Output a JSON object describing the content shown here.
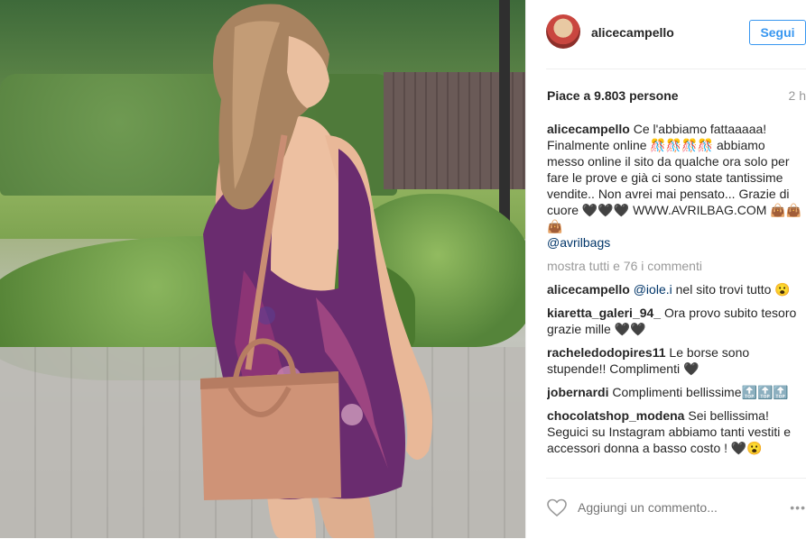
{
  "post": {
    "username": "alicecampello",
    "follow_label": "Segui",
    "likes": "Piace a 9.803 persone",
    "time": "2 h",
    "caption_text": " Ce l'abbiamo fattaaaaa! Finalmente online 🎊🎊🎊🎊 abbiamo messo online il sito da qualche ora solo per fare le prove e già ci sono state tantissime vendite.. Non avrei mai pensato... Grazie di cuore 🖤🖤🖤 WWW.AVRILBAG.COM 👜👜👜",
    "caption_mention": "@avrilbags",
    "load_more": "mostra tutti e 76 i commenti",
    "comments": [
      {
        "author": "alicecampello",
        "mention": "@iole.i",
        "text": " nel sito trovi tutto 😮"
      },
      {
        "author": "kiaretta_galeri_94_",
        "mention": "",
        "text": " Ora provo subito tesoro grazie mille 🖤🖤"
      },
      {
        "author": "racheledodopires11",
        "mention": "",
        "text": " Le borse sono stupende!! Complimenti 🖤"
      },
      {
        "author": "jobernardi",
        "mention": "",
        "text": " Complimenti bellissime🔝🔝🔝"
      },
      {
        "author": "chocolatshop_modena",
        "mention": "",
        "text": " Sei bellissima! Seguici su Instagram abbiamo tanti vestiti e accessori donna a basso costo ! 🖤😮"
      }
    ],
    "add_comment_placeholder": "Aggiungi un commento...",
    "more_label": "•••"
  },
  "colors": {
    "accent": "#3897f0",
    "text": "#262626",
    "muted": "#999999",
    "link": "#003569"
  },
  "icons": {
    "heart": "heart-outline-icon",
    "more": "ellipsis-icon"
  }
}
